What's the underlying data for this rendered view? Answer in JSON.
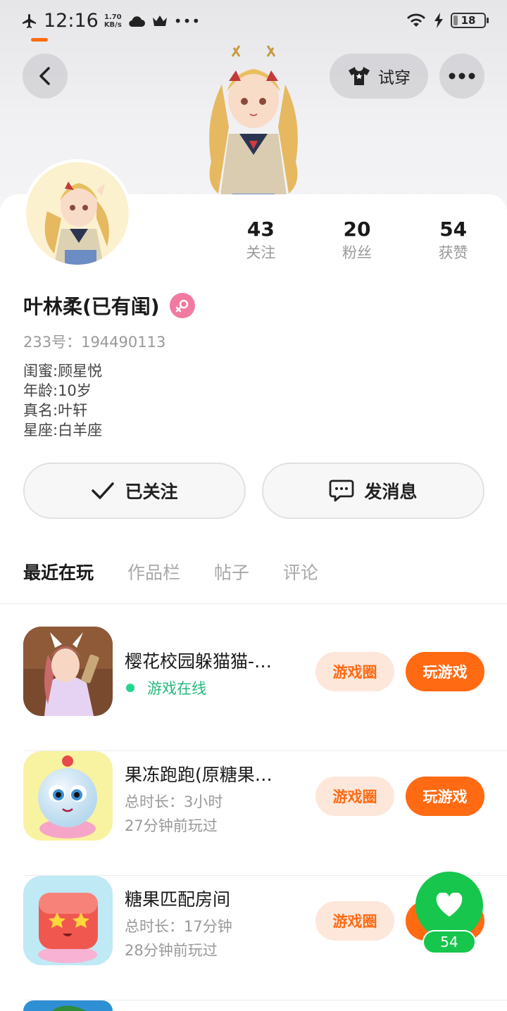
{
  "status_bar": {
    "time": "12:16",
    "net_speed_value": "1.70",
    "net_speed_unit": "KB/s",
    "battery": "18"
  },
  "header": {
    "tryon_label": "试穿"
  },
  "profile": {
    "stats": [
      {
        "value": "43",
        "label": "关注"
      },
      {
        "value": "20",
        "label": "粉丝"
      },
      {
        "value": "54",
        "label": "获赞"
      }
    ],
    "username": "叶林柔(已有闺)",
    "gender": "female",
    "uid": "233号：194490113",
    "bio": [
      "闺蜜:顾星悦",
      "年龄:10岁",
      "真名:叶轩",
      "星座:白羊座"
    ]
  },
  "actions": {
    "follow_label": "已关注",
    "message_label": "发消息"
  },
  "tabs": [
    {
      "label": "最近在玩",
      "active": true
    },
    {
      "label": "作品栏",
      "active": false
    },
    {
      "label": "帖子",
      "active": false
    },
    {
      "label": "评论",
      "active": false
    }
  ],
  "games": [
    {
      "title": "樱花校园躲猫猫-…",
      "line1": "游戏在线",
      "line2": "",
      "circle_label": "游戏圈",
      "play_label": "玩游戏"
    },
    {
      "title": "果冻跑跑(原糖果…",
      "line1": "总时长：3小时",
      "line2": "27分钟前玩过",
      "circle_label": "游戏圈",
      "play_label": "玩游戏"
    },
    {
      "title": "糖果匹配房间",
      "line1": "总时长：17分钟",
      "line2": "28分钟前玩过",
      "circle_label": "游戏圈",
      "play_label": "玩游戏"
    }
  ],
  "like": {
    "count": "54"
  },
  "colors": {
    "accent": "#ff6a13",
    "accent_light": "#fde7da",
    "online_green": "#23b97b",
    "like_green": "#16c64d",
    "gender_pink": "#f27aa0"
  }
}
